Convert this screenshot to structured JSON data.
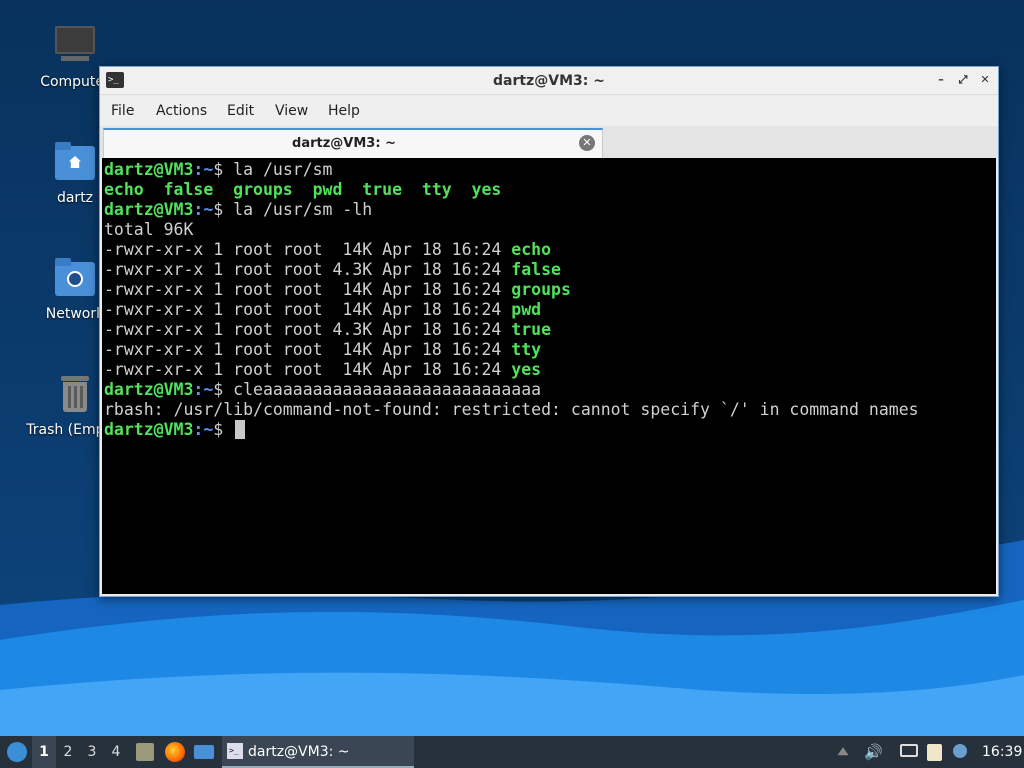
{
  "desktop": {
    "icons": [
      {
        "label": "Computer",
        "icon": "computer-icon"
      },
      {
        "label": "dartz",
        "icon": "home-folder-icon"
      },
      {
        "label": "Network",
        "icon": "network-folder-icon"
      },
      {
        "label": "Trash (Empty)",
        "icon": "trash-icon"
      }
    ]
  },
  "window": {
    "title": "dartz@VM3: ~",
    "menu": [
      "File",
      "Actions",
      "Edit",
      "View",
      "Help"
    ],
    "tab_title": "dartz@VM3: ~"
  },
  "terminal": {
    "prompt_user": "dartz@VM3",
    "prompt_path": ":~",
    "prompt_symbol": "$",
    "lines": [
      {
        "type": "prompt",
        "cmd": " la /usr/sm"
      },
      {
        "type": "green",
        "text": "echo  false  groups  pwd  true  tty  yes"
      },
      {
        "type": "prompt",
        "cmd": " la /usr/sm -lh"
      },
      {
        "type": "plain",
        "text": "total 96K"
      },
      {
        "type": "file",
        "meta": "-rwxr-xr-x 1 root root  14K Apr 18 16:24 ",
        "name": "echo"
      },
      {
        "type": "file",
        "meta": "-rwxr-xr-x 1 root root 4.3K Apr 18 16:24 ",
        "name": "false"
      },
      {
        "type": "file",
        "meta": "-rwxr-xr-x 1 root root  14K Apr 18 16:24 ",
        "name": "groups"
      },
      {
        "type": "file",
        "meta": "-rwxr-xr-x 1 root root  14K Apr 18 16:24 ",
        "name": "pwd"
      },
      {
        "type": "file",
        "meta": "-rwxr-xr-x 1 root root 4.3K Apr 18 16:24 ",
        "name": "true"
      },
      {
        "type": "file",
        "meta": "-rwxr-xr-x 1 root root  14K Apr 18 16:24 ",
        "name": "tty"
      },
      {
        "type": "file",
        "meta": "-rwxr-xr-x 1 root root  14K Apr 18 16:24 ",
        "name": "yes"
      },
      {
        "type": "prompt",
        "cmd": " cleaaaaaaaaaaaaaaaaaaaaaaaaaaaa"
      },
      {
        "type": "plain",
        "text": "rbash: /usr/lib/command-not-found: restricted: cannot specify `/' in command names"
      },
      {
        "type": "prompt",
        "cmd": " ",
        "cursor": true
      }
    ]
  },
  "taskbar": {
    "workspaces": [
      "1",
      "2",
      "3",
      "4"
    ],
    "active_workspace": "1",
    "task_label": "dartz@VM3: ~",
    "clock": "16:39"
  },
  "colors": {
    "prompt_green": "#4fe35a",
    "prompt_blue": "#5c96e8",
    "terminal_bg": "#000000",
    "accent": "#4a90d9"
  }
}
